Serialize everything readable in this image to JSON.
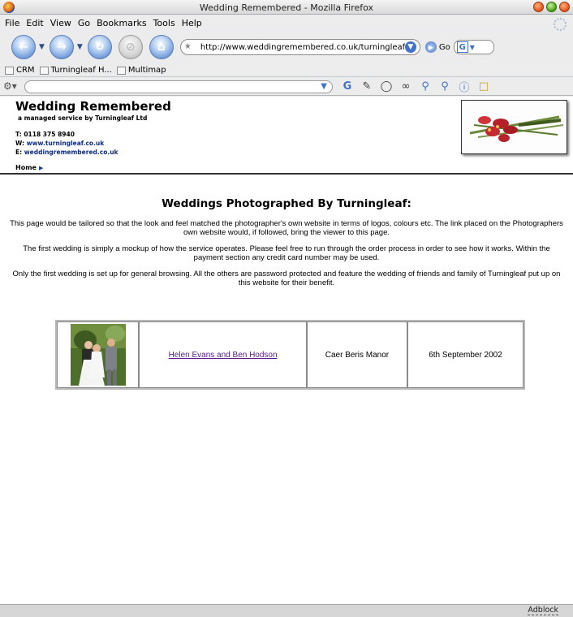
{
  "window": {
    "title": "Wedding Remembered - Mozilla Firefox"
  },
  "menu": [
    "File",
    "Edit",
    "View",
    "Go",
    "Bookmarks",
    "Tools",
    "Help"
  ],
  "navigation": {
    "url": "http://www.weddingremembered.co.uk/turningleaf/index.",
    "go_label": "Go"
  },
  "bookmarks": [
    "CRM",
    "Turningleaf H...",
    "Multimap"
  ],
  "site": {
    "title": "Wedding Remembered",
    "tagline": "a managed service by Turningleaf Ltd",
    "phone": "T: 0118 375 8940",
    "web_prefix": "W:",
    "web": "www.turningleaf.co.uk",
    "email_prefix": "E:",
    "email": "weddingremembered.co.uk",
    "home": "Home"
  },
  "content": {
    "heading": "Weddings Photographed By Turningleaf:",
    "paragraphs": [
      "This page would be tailored so that the look and feel matched the photographer's own website in terms of logos, colours etc. The link placed on the Photographers own website would, if followed, bring the viewer to this page.",
      "The first wedding is simply a mockup of how the service operates. Please feel free to run through the order process in order to see how it works. Within the payment section any credit card number may be used.",
      "Only the first wedding is set up for general browsing. All the others are password protected and feature the wedding of friends and family of Turningleaf put up on this website for their benefit."
    ],
    "weddings": [
      {
        "couple": "Helen Evans and Ben Hodson",
        "venue": "Caer Beris Manor",
        "date": "6th September 2002"
      }
    ]
  },
  "status": {
    "adblock": "Adblock"
  }
}
